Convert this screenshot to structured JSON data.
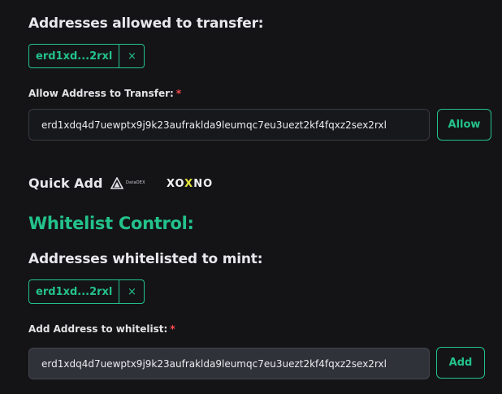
{
  "transfer": {
    "heading": "Addresses allowed to transfer:",
    "chip_label": "erd1xd...2rxl",
    "chip_remove": "×",
    "input_label": "Allow Address to Transfer:",
    "required_mark": "*",
    "input_value": "erd1xdq4d7uewptx9j9k23aufraklda9leumqc7eu3uezt2kf4fqxz2sex2rxl",
    "button_label": "Allow"
  },
  "quick_add": {
    "label": "Quick Add",
    "logos": [
      {
        "name": "DataDEX",
        "text": "DataDEX",
        "icon": "datadex-logo-icon"
      },
      {
        "name": "XOXNO",
        "text_before": "XO",
        "text_x": "X",
        "text_after": "NO",
        "icon": "xoxno-logo-icon"
      }
    ]
  },
  "whitelist": {
    "title": "Whitelist Control:",
    "heading": "Addresses whitelisted to mint:",
    "chip_label": "erd1xd...2rxl",
    "chip_remove": "×",
    "input_label": "Add Address to whitelist:",
    "required_mark": "*",
    "input_value": "erd1xdq4d7uewptx9j9k23aufraklda9leumqc7eu3uezt2kf4fqxz2sex2rxl",
    "button_label": "Add"
  },
  "colors": {
    "accent": "#23c28a",
    "required": "#ff4b4b",
    "background": "#141417"
  }
}
